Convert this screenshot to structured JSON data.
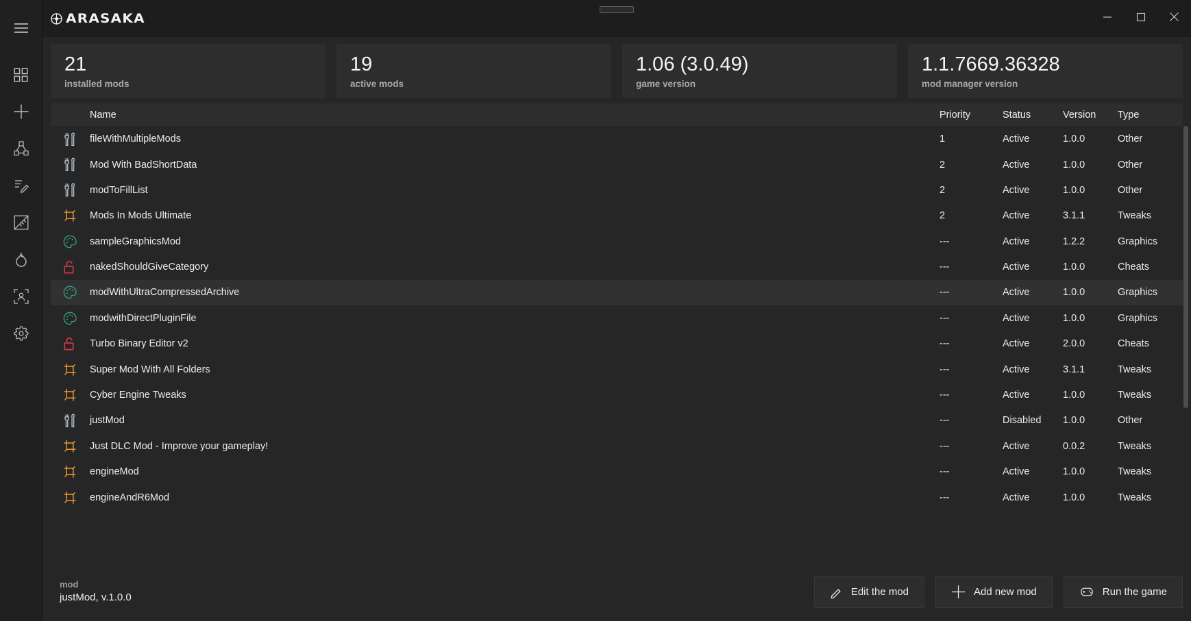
{
  "window": {
    "app_title": "ARASAKA",
    "controls": {
      "minimize": "minimize-icon",
      "maximize": "maximize-icon",
      "close": "close-icon"
    },
    "drag_grip": "window-drag-grip"
  },
  "sidebar": {
    "items": [
      {
        "name": "menu",
        "icon": "hamburger-menu-icon"
      },
      {
        "name": "dashboard",
        "icon": "grid-dashboard-icon"
      },
      {
        "name": "add",
        "icon": "plus-icon"
      },
      {
        "name": "assets",
        "icon": "cube-node-icon"
      },
      {
        "name": "scripts",
        "icon": "script-pen-icon"
      },
      {
        "name": "measure",
        "icon": "ruler-icon"
      },
      {
        "name": "flame",
        "icon": "flame-icon"
      },
      {
        "name": "character",
        "icon": "person-frame-icon"
      },
      {
        "name": "settings",
        "icon": "gear-icon"
      }
    ]
  },
  "stats": [
    {
      "value": "21",
      "label": "installed mods"
    },
    {
      "value": "19",
      "label": "active mods"
    },
    {
      "value": "1.06 (3.0.49)",
      "label": "game version"
    },
    {
      "value": "1.1.7669.36328",
      "label": "mod manager version"
    }
  ],
  "table": {
    "columns": {
      "name": "Name",
      "priority": "Priority",
      "status": "Status",
      "version": "Version",
      "type": "Type"
    },
    "rows": [
      {
        "icon": "tools-icon",
        "name": "fileWithMultipleMods",
        "priority": "1",
        "status": "Active",
        "version": "1.0.0",
        "type": "Other"
      },
      {
        "icon": "tools-icon",
        "name": "Mod With BadShortData",
        "priority": "2",
        "status": "Active",
        "version": "1.0.0",
        "type": "Other"
      },
      {
        "icon": "tools-icon",
        "name": "modToFillList",
        "priority": "2",
        "status": "Active",
        "version": "1.0.0",
        "type": "Other"
      },
      {
        "icon": "crop-icon",
        "name": "Mods In Mods Ultimate",
        "priority": "2",
        "status": "Active",
        "version": "3.1.1",
        "type": "Tweaks"
      },
      {
        "icon": "palette-icon",
        "name": "sampleGraphicsMod",
        "priority": "---",
        "status": "Active",
        "version": "1.2.2",
        "type": "Graphics"
      },
      {
        "icon": "unlock-icon",
        "name": "nakedShouldGiveCategory",
        "priority": "---",
        "status": "Active",
        "version": "1.0.0",
        "type": "Cheats"
      },
      {
        "icon": "palette-icon",
        "name": "modWithUltraCompressedArchive",
        "priority": "---",
        "status": "Active",
        "version": "1.0.0",
        "type": "Graphics"
      },
      {
        "icon": "palette-icon",
        "name": "modwithDirectPluginFile",
        "priority": "---",
        "status": "Active",
        "version": "1.0.0",
        "type": "Graphics"
      },
      {
        "icon": "unlock-icon",
        "name": "Turbo Binary Editor v2",
        "priority": "---",
        "status": "Active",
        "version": "2.0.0",
        "type": "Cheats"
      },
      {
        "icon": "crop-icon",
        "name": "Super Mod With All Folders",
        "priority": "---",
        "status": "Active",
        "version": "3.1.1",
        "type": "Tweaks"
      },
      {
        "icon": "crop-icon",
        "name": "Cyber Engine Tweaks",
        "priority": "---",
        "status": "Active",
        "version": "1.0.0",
        "type": "Tweaks"
      },
      {
        "icon": "tools-icon",
        "name": "justMod",
        "priority": "---",
        "status": "Disabled",
        "version": "1.0.0",
        "type": "Other"
      },
      {
        "icon": "crop-icon",
        "name": "Just DLC Mod - Improve your gameplay!",
        "priority": "---",
        "status": "Active",
        "version": "0.0.2",
        "type": "Tweaks"
      },
      {
        "icon": "crop-icon",
        "name": "engineMod",
        "priority": "---",
        "status": "Active",
        "version": "1.0.0",
        "type": "Tweaks"
      },
      {
        "icon": "crop-icon",
        "name": "engineAndR6Mod",
        "priority": "---",
        "status": "Active",
        "version": "1.0.0",
        "type": "Tweaks"
      }
    ],
    "selected_row_index": 6
  },
  "footer": {
    "selection_label": "mod",
    "selection_value": "justMod, v.1.0.0",
    "buttons": [
      {
        "label": "Edit the mod",
        "icon": "pencil-icon"
      },
      {
        "label": "Add new mod",
        "icon": "plus-icon"
      },
      {
        "label": "Run the game",
        "icon": "gamepad-icon"
      }
    ]
  },
  "colors": {
    "background": "#262626",
    "rail": "#202020",
    "card": "#2d2d2d",
    "titlebar": "#1d1d1d",
    "selected_row": "#313131",
    "icon_tools": "#b8c4cc",
    "icon_crop": "#e8972e",
    "icon_palette": "#2f9e7e",
    "icon_unlock": "#d03a42",
    "text_primary": "#efefef",
    "text_muted": "#a8a8a8"
  }
}
